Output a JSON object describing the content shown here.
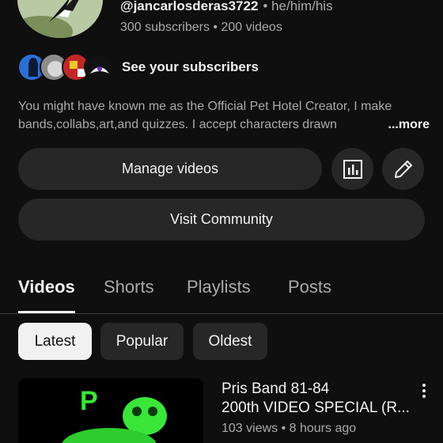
{
  "channel": {
    "handle": "@jancarlosderas3722",
    "pronouns": "• he/him/his",
    "stats": "300 subscribers • 200 videos",
    "avatar_icon": "magpie-bird-avatar"
  },
  "subscribers": {
    "label": "See your subscribers",
    "avatars": [
      "subscriber-avatar-1",
      "subscriber-avatar-2",
      "subscriber-avatar-3",
      "subscriber-avatar-4"
    ]
  },
  "description": {
    "line1": "You might have known me as the Official Pet Hotel Creator, I make",
    "line2": "bands,collabs,art,and quizzes. I accept characters drawn",
    "more_label": "...more"
  },
  "actions": {
    "manage_videos": "Manage videos",
    "analytics_icon": "analytics-icon",
    "edit_icon": "pencil-icon",
    "visit_community": "Visit Community"
  },
  "tabs": [
    {
      "label": "Videos",
      "active": true
    },
    {
      "label": "Shorts",
      "active": false
    },
    {
      "label": "Playlists",
      "active": false
    },
    {
      "label": "Posts",
      "active": false
    }
  ],
  "chips": [
    {
      "label": "Latest",
      "selected": true
    },
    {
      "label": "Popular",
      "selected": false
    },
    {
      "label": "Oldest",
      "selected": false
    }
  ],
  "video": {
    "title_line1": "Pris Band 81-84",
    "title_line2": "200th VIDEO SPECIAL (R...",
    "meta": "103 views • 8 hours ago",
    "thumbnail_letter": "P"
  },
  "colors": {
    "background": "#0f0f0f",
    "surface": "#272727",
    "text_primary": "#f1f1f1",
    "text_secondary": "#aaaaaa",
    "thumbnail_green": "#39e639"
  }
}
